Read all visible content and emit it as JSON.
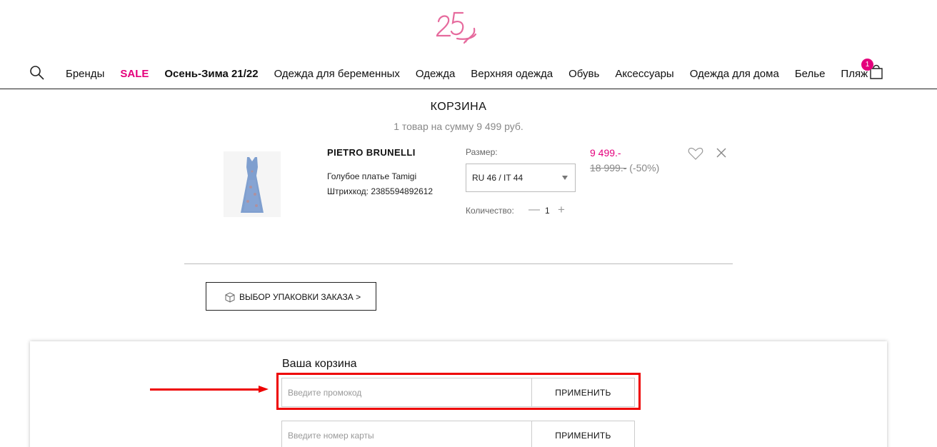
{
  "header": {
    "logo_text": "25",
    "nav_items": [
      {
        "label": "Бренды"
      },
      {
        "label": "SALE"
      },
      {
        "label": "Осень-Зима 21/22"
      },
      {
        "label": "Одежда для беременных"
      },
      {
        "label": "Одежда"
      },
      {
        "label": "Верхняя одежда"
      },
      {
        "label": "Обувь"
      },
      {
        "label": "Аксессуары"
      },
      {
        "label": "Одежда для дома"
      },
      {
        "label": "Белье"
      },
      {
        "label": "Пляж"
      }
    ],
    "cart_count": "1"
  },
  "cart": {
    "title": "КОРЗИНА",
    "summary": "1 товар на сумму 9 499 руб."
  },
  "item": {
    "brand": "PIETRO BRUNELLI",
    "name": "Голубое платье Tamigi",
    "barcode": "Штрихкод: 2385594892612",
    "size_label": "Размер:",
    "size_value": "RU 46 / IT 44",
    "qty_label": "Количество:",
    "qty_minus": "—",
    "qty_value": "1",
    "qty_plus": "+",
    "price_new": "9 499.-",
    "price_old": "18 999.-",
    "discount": "(-50%)"
  },
  "packaging": {
    "button_label": "ВЫБОР УПАКОВКИ ЗАКАЗА >"
  },
  "summary_panel": {
    "title": "Ваша корзина",
    "promo_placeholder": "Введите промокод",
    "promo_apply": "ПРИМЕНИТЬ",
    "card_placeholder": "Введите номер карты",
    "card_apply": "ПРИМЕНИТЬ"
  },
  "colors": {
    "accent": "#e4007c",
    "annotation": "#ee0000"
  },
  "icons": [
    "logo-icon",
    "search-icon",
    "cart-icon",
    "heart-icon",
    "close-icon",
    "box-icon"
  ]
}
